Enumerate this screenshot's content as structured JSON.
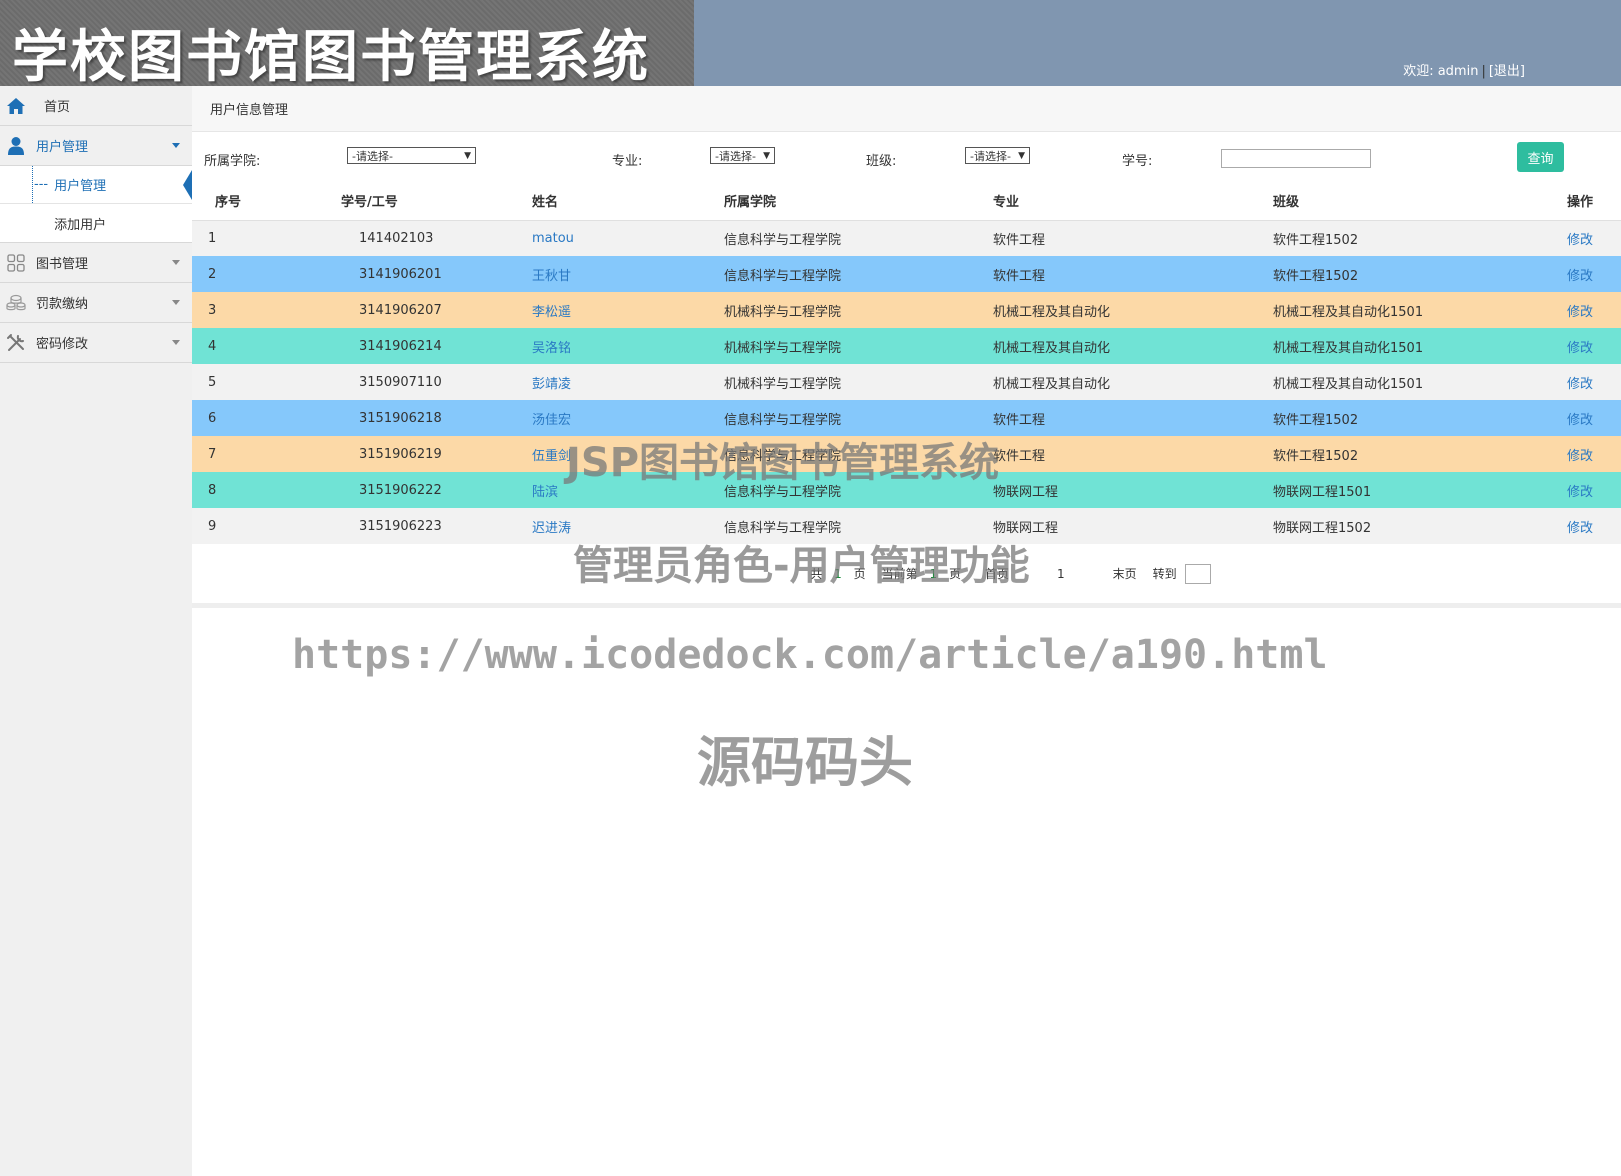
{
  "header": {
    "title": "学校图书馆图书管理系统",
    "welcome_label": "欢迎:",
    "username": "admin",
    "separator": "|",
    "logout": "[退出]"
  },
  "sidebar": {
    "home": "首页",
    "groups": [
      {
        "label": "用户管理",
        "icon": "user-icon",
        "active": true,
        "items": [
          {
            "label": "用户管理",
            "current": true
          },
          {
            "label": "添加用户",
            "current": false
          }
        ]
      },
      {
        "label": "图书管理",
        "icon": "grid-icon",
        "active": false
      },
      {
        "label": "罚款缴纳",
        "icon": "coins-icon",
        "active": false
      },
      {
        "label": "密码修改",
        "icon": "tools-icon",
        "active": false
      }
    ],
    "dash": "---"
  },
  "breadcrumb": "用户信息管理",
  "filters": {
    "college_label": "所属学院:",
    "college_value": "-请选择-",
    "major_label": "专业:",
    "major_value": "-请选择-",
    "class_label": "班级:",
    "class_value": "-请选择-",
    "id_label": "学号:",
    "id_value": "",
    "query_button": "查询"
  },
  "table": {
    "headers": [
      "序号",
      "学号/工号",
      "姓名",
      "所属学院",
      "专业",
      "班级",
      "操作"
    ],
    "rows": [
      {
        "no": "1",
        "id": "141402103",
        "name": "matou",
        "college": "信息科学与工程学院",
        "major": "软件工程",
        "class": "软件工程1502",
        "op": "修改",
        "color": "gray"
      },
      {
        "no": "2",
        "id": "3141906201",
        "name": "王秋甘",
        "college": "信息科学与工程学院",
        "major": "软件工程",
        "class": "软件工程1502",
        "op": "修改",
        "color": "blue"
      },
      {
        "no": "3",
        "id": "3141906207",
        "name": "李松遥",
        "college": "机械科学与工程学院",
        "major": "机械工程及其自动化",
        "class": "机械工程及其自动化1501",
        "op": "修改",
        "color": "orange"
      },
      {
        "no": "4",
        "id": "3141906214",
        "name": "吴洛铭",
        "college": "机械科学与工程学院",
        "major": "机械工程及其自动化",
        "class": "机械工程及其自动化1501",
        "op": "修改",
        "color": "teal"
      },
      {
        "no": "5",
        "id": "3150907110",
        "name": "彭靖凌",
        "college": "机械科学与工程学院",
        "major": "机械工程及其自动化",
        "class": "机械工程及其自动化1501",
        "op": "修改",
        "color": "gray"
      },
      {
        "no": "6",
        "id": "3151906218",
        "name": "汤佳宏",
        "college": "信息科学与工程学院",
        "major": "软件工程",
        "class": "软件工程1502",
        "op": "修改",
        "color": "blue"
      },
      {
        "no": "7",
        "id": "3151906219",
        "name": "伍重剑",
        "college": "信息科学与工程学院",
        "major": "软件工程",
        "class": "软件工程1502",
        "op": "修改",
        "color": "orange"
      },
      {
        "no": "8",
        "id": "3151906222",
        "name": "陆滨",
        "college": "信息科学与工程学院",
        "major": "物联网工程",
        "class": "物联网工程1501",
        "op": "修改",
        "color": "teal"
      },
      {
        "no": "9",
        "id": "3151906223",
        "name": "迟进涛",
        "college": "信息科学与工程学院",
        "major": "物联网工程",
        "class": "物联网工程1502",
        "op": "修改",
        "color": "gray"
      }
    ]
  },
  "pager": {
    "total_prefix": "共",
    "total_pages": "1",
    "total_suffix": "页",
    "current_prefix": "当前第",
    "current_page": "1",
    "current_suffix": "页",
    "first": "首页",
    "page_num": "1",
    "last": "末页",
    "goto": "转到"
  },
  "watermarks": {
    "line1": "JSP图书馆图书管理系统",
    "line2": "管理员角色-用户管理功能",
    "line3": "https://www.icodedock.com/article/a190.html",
    "line4": "源码码头"
  },
  "colors": {
    "header_bg": "#8096b0",
    "accent_blue": "#1e6fb5",
    "query_button": "#2ebd9f",
    "row_gray": "#f2f2f2",
    "row_blue": "#85c8fb",
    "row_orange": "#fcd9a7",
    "row_teal": "#70e3d5"
  }
}
